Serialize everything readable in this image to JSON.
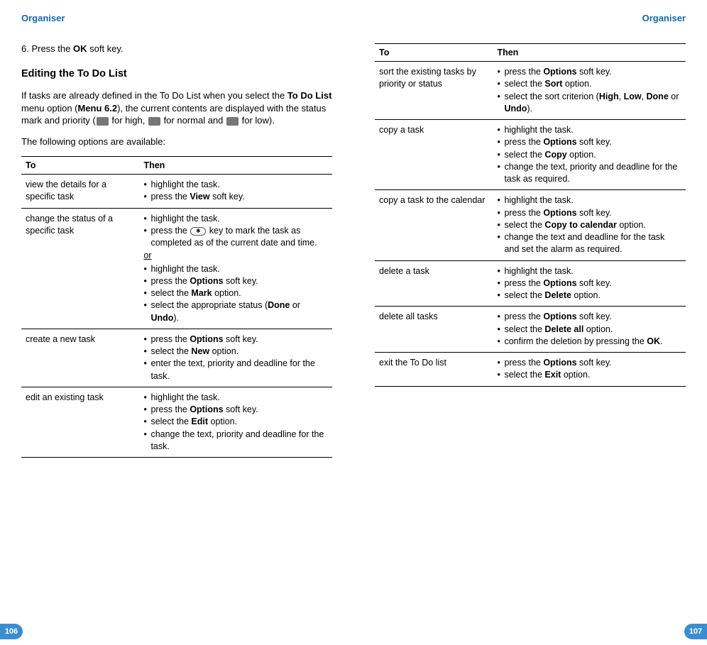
{
  "header": {
    "left": "Organiser",
    "right": "Organiser"
  },
  "step6": {
    "prefix": "6. Press the ",
    "bold": "OK",
    "suffix": " soft key."
  },
  "sectionTitle": "Editing the To Do List",
  "intro": {
    "p1a": "If tasks are already defined in the To Do List when you select the ",
    "p1bold1": "To Do List",
    "p1b": " menu option (",
    "p1bold2": "Menu 6.2",
    "p1c": "), the current contents are displayed with the status mark and priority (",
    "p1d": " for high, ",
    "p1e": " for normal and ",
    "p1f": " for low).",
    "p2": "The following options are available:"
  },
  "table1": {
    "headTo": "To",
    "headThen": "Then",
    "rows": [
      {
        "to": "view the details for a specific task",
        "then": [
          [
            "highlight the task."
          ],
          [
            "press the ",
            "b:View",
            " soft key."
          ]
        ]
      },
      {
        "to": "change the status of a specific task",
        "then": [
          [
            "highlight the task."
          ],
          [
            "press the ",
            "key:*",
            " key to mark the task as completed as of the current date and time."
          ]
        ],
        "or": "or",
        "then2": [
          [
            "highlight the task."
          ],
          [
            "press the ",
            "b:Options",
            " soft key."
          ],
          [
            "select the ",
            "b:Mark",
            " option."
          ],
          [
            "select the appropriate status (",
            "b:Done",
            " or ",
            "b:Undo",
            ")."
          ]
        ]
      },
      {
        "to": "create a new task",
        "then": [
          [
            "press the ",
            "b:Options",
            " soft key."
          ],
          [
            "select the ",
            "b:New",
            " option."
          ],
          [
            "enter the text, priority and deadline for the task."
          ]
        ]
      },
      {
        "to": "edit an existing task",
        "then": [
          [
            "highlight the task."
          ],
          [
            "press the ",
            "b:Options",
            " soft key."
          ],
          [
            "select the ",
            "b:Edit",
            " option."
          ],
          [
            "change the text, priority and deadline for the task."
          ]
        ]
      }
    ]
  },
  "table2": {
    "headTo": "To",
    "headThen": "Then",
    "rows": [
      {
        "to": "sort the existing tasks by priority or status",
        "then": [
          [
            "press the ",
            "b:Options",
            " soft key."
          ],
          [
            "select the ",
            "b:Sort",
            " option."
          ],
          [
            "select the sort criterion (",
            "b:High",
            ", ",
            "b:Low",
            ", ",
            "b:Done",
            " or ",
            "b:Undo",
            ")."
          ]
        ]
      },
      {
        "to": "copy a task",
        "then": [
          [
            "highlight the task."
          ],
          [
            "press the ",
            "b:Options",
            " soft key."
          ],
          [
            "select the ",
            "b:Copy",
            " option."
          ],
          [
            "change the text, priority and deadline for the task as required."
          ]
        ]
      },
      {
        "to": "copy a task to the calendar",
        "then": [
          [
            "highlight the task."
          ],
          [
            "press the ",
            "b:Options",
            " soft key."
          ],
          [
            "select the ",
            "b:Copy to calendar",
            " option."
          ],
          [
            "change the text and deadline for the task and set the alarm as required."
          ]
        ]
      },
      {
        "to": "delete a task",
        "then": [
          [
            "highlight the task."
          ],
          [
            "press the ",
            "b:Options",
            " soft key."
          ],
          [
            "select the ",
            "b:Delete",
            " option."
          ]
        ]
      },
      {
        "to": "delete all tasks",
        "then": [
          [
            "press the ",
            "b:Options",
            " soft key."
          ],
          [
            "select the ",
            "b:Delete all",
            " option."
          ],
          [
            "confirm the deletion by pressing the ",
            "b:OK",
            "."
          ]
        ]
      },
      {
        "to": "exit the To Do list",
        "then": [
          [
            "press the ",
            "b:Options",
            " soft key."
          ],
          [
            "select the ",
            "b:Exit",
            " option."
          ]
        ]
      }
    ]
  },
  "pageNums": {
    "left": "106",
    "right": "107"
  }
}
